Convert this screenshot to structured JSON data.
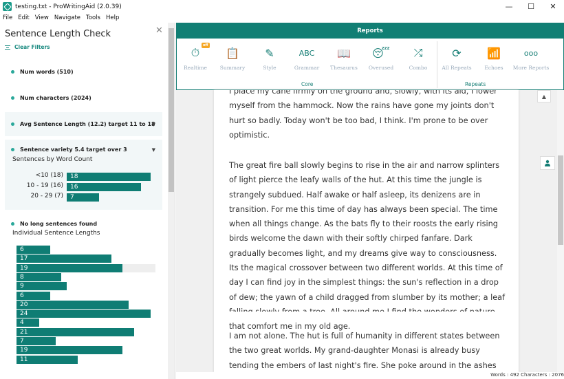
{
  "window": {
    "title": "testing.txt - ProWritingAid (2.0.39)",
    "minimize": "—",
    "maximize": "☐",
    "close": "✕"
  },
  "menu": [
    "File",
    "Edit",
    "View",
    "Navigate",
    "Tools",
    "Help"
  ],
  "left_panel": {
    "title": "Sentence Length Check",
    "close": "✕",
    "clear_filters": "Clear Filters",
    "stats": {
      "num_words": "Num words (510)",
      "num_characters": "Num characters (2024)",
      "avg_sentence_length": "Avg Sentence Length (12.2) target 11 to 18",
      "sentence_variety": "Sentence variety 5.4 target over 3",
      "no_long": "No long sentences found"
    },
    "word_count_title": "Sentences by Word Count",
    "word_count_bars": [
      {
        "label": "<10 (18)",
        "value": 18
      },
      {
        "label": "10 - 19 (16)",
        "value": 16
      },
      {
        "label": "20 - 29 (7)",
        "value": 7
      }
    ],
    "individual_title": "Individual Sentence Lengths",
    "individual_bars": [
      6,
      17,
      19,
      8,
      9,
      6,
      20,
      24,
      4,
      21,
      7,
      19,
      11
    ],
    "caret": "▼"
  },
  "ribbon": {
    "header": "Reports",
    "tools": [
      {
        "name": "realtime",
        "label": "Realtime",
        "icon": "⏱",
        "badge": "off"
      },
      {
        "name": "summary",
        "label": "Summary",
        "icon": "📋"
      },
      {
        "name": "style",
        "label": "Style",
        "icon": "✎"
      },
      {
        "name": "grammar",
        "label": "Grammar",
        "icon": "ABC"
      },
      {
        "name": "thesaurus",
        "label": "Thesaurus",
        "icon": "📖"
      },
      {
        "name": "overused",
        "label": "Overused",
        "icon": "😴"
      },
      {
        "name": "combo",
        "label": "Combo",
        "icon": "⤮"
      },
      {
        "name": "all-repeats",
        "label": "All Repeats",
        "icon": "⟳"
      },
      {
        "name": "echoes",
        "label": "Echoes",
        "icon": "📶"
      },
      {
        "name": "more-reports",
        "label": "More Reports",
        "icon": "ooo"
      }
    ],
    "groups": {
      "core": "Core",
      "repeats": "Repeats"
    }
  },
  "document": {
    "paragraphs": [
      "I place my cane firmly on the ground and, slowly, with its aid, I lower myself from the hammock. Now the rains have gone my joints don't hurt so badly. Today won't be too bad, I think. I'm prone to be over optimistic.",
      "The great fire ball slowly begins to rise in the air and narrow splinters of light pierce the leafy walls of the hut. At this time the jungle is strangely subdued. Half awake or half asleep, its denizens are in transition. For me this time of day has always been special. The time when all things change. As the bats fly to their roosts the early rising birds welcome the dawn with their softly chirped fanfare. Dark gradually becomes light, and my dreams give way to consciousness. Its the magical crossover between two different worlds. At this time of day I can find joy in the simplest things: the sun's reflection in a drop of dew; the yawn of a child dragged from slumber by its mother; a leaf falling slowly from a tree. All around me I find the wonders of nature that comfort me in my old age.",
      "I am not alone. The hut is full of humanity in different states between the two great worlds. My grand-daughter Monasi is already busy tending the embers of last night's fire. She poke around in the ashes to find an ember"
    ],
    "scroll_up": "▲"
  },
  "status": {
    "text": "Words : 492 Characters : 2076"
  },
  "colors": {
    "accent": "#117f74",
    "bar": "#0f7d74",
    "dot": "#2aa89a"
  }
}
